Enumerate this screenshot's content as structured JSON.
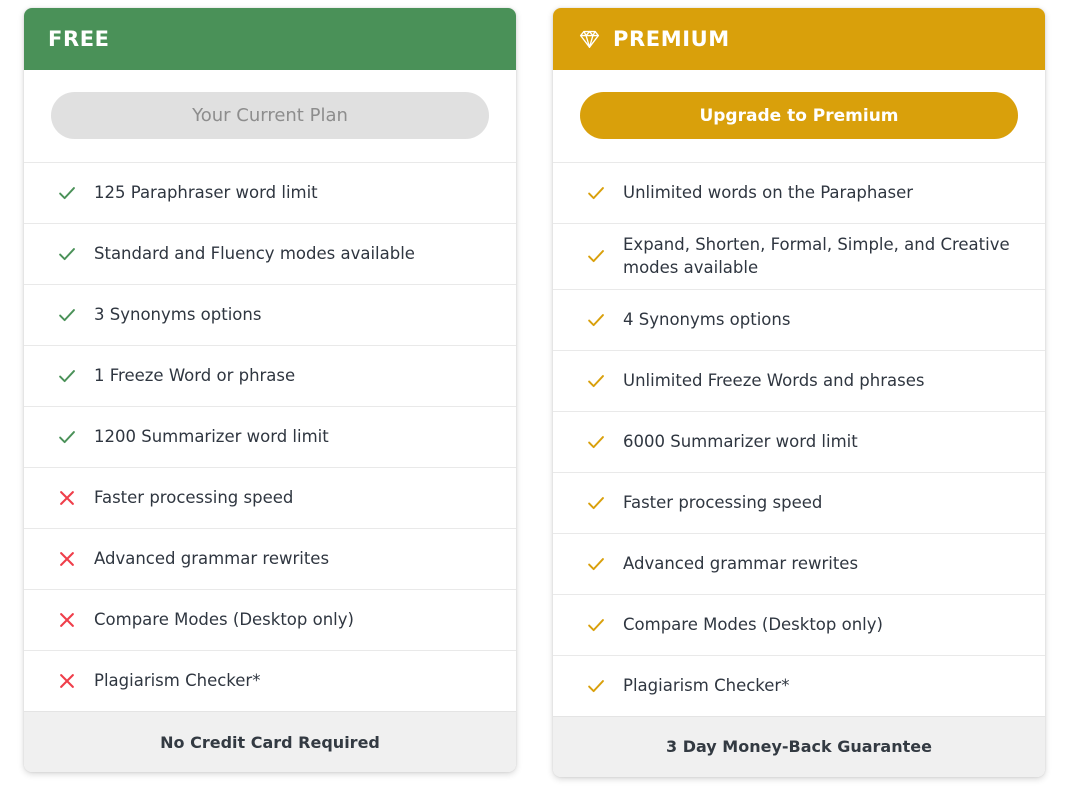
{
  "colors": {
    "free_accent": "#4a9158",
    "premium_accent": "#d9a00b",
    "check_free": "#4a9158",
    "check_premium": "#d9a00b",
    "cross": "#ef3e4a",
    "text": "#2f3640",
    "footer_bg": "#f0f0f0",
    "disabled_btn": "#e0e0e0"
  },
  "plans": [
    {
      "id": "free",
      "title": "FREE",
      "icon": null,
      "cta": {
        "label": "Your Current Plan",
        "state": "disabled"
      },
      "features": [
        {
          "mark": "check",
          "text": "125 Paraphraser word limit"
        },
        {
          "mark": "check",
          "text": "Standard and Fluency modes available"
        },
        {
          "mark": "check",
          "text": "3 Synonyms options"
        },
        {
          "mark": "check",
          "text": "1 Freeze Word or phrase"
        },
        {
          "mark": "check",
          "text": "1200 Summarizer word limit"
        },
        {
          "mark": "cross",
          "text": "Faster processing speed"
        },
        {
          "mark": "cross",
          "text": "Advanced grammar rewrites"
        },
        {
          "mark": "cross",
          "text": "Compare Modes (Desktop only)"
        },
        {
          "mark": "cross",
          "text": "Plagiarism Checker*"
        }
      ],
      "footer": "No Credit Card Required"
    },
    {
      "id": "premium",
      "title": "PREMIUM",
      "icon": "diamond-icon",
      "cta": {
        "label": "Upgrade to Premium",
        "state": "enabled"
      },
      "features": [
        {
          "mark": "check",
          "text": "Unlimited words on the Paraphaser"
        },
        {
          "mark": "check",
          "text": "Expand, Shorten, Formal, Simple, and Creative modes available"
        },
        {
          "mark": "check",
          "text": "4 Synonyms options"
        },
        {
          "mark": "check",
          "text": "Unlimited Freeze Words and phrases"
        },
        {
          "mark": "check",
          "text": "6000 Summarizer word limit"
        },
        {
          "mark": "check",
          "text": "Faster processing speed"
        },
        {
          "mark": "check",
          "text": "Advanced grammar rewrites"
        },
        {
          "mark": "check",
          "text": "Compare Modes (Desktop only)"
        },
        {
          "mark": "check",
          "text": "Plagiarism Checker*"
        }
      ],
      "footer": "3 Day Money-Back Guarantee"
    }
  ]
}
